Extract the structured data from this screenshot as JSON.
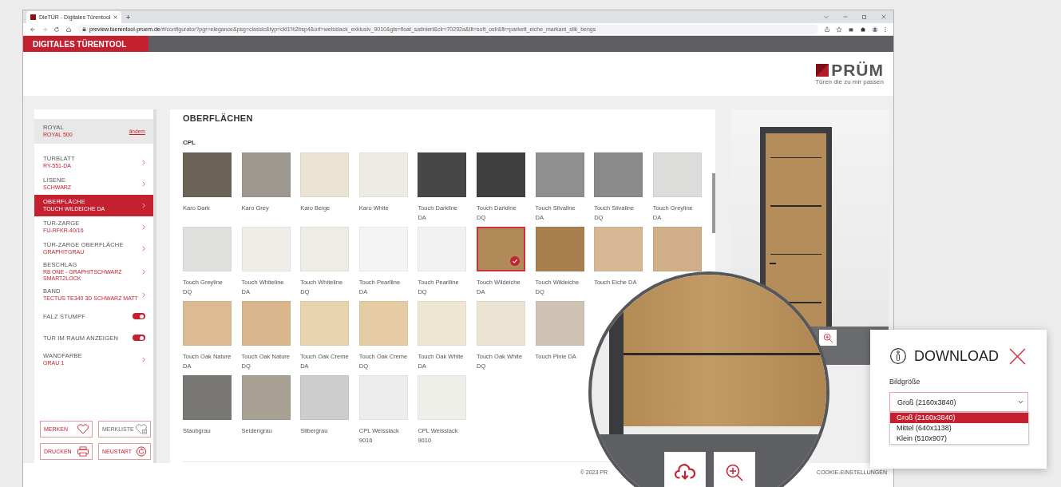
{
  "browser": {
    "tab_title": "DieTÜR - Digitales Türentool",
    "url_host": "preview.tuerentool-pruem.de",
    "url_path": "/#/configurator?pgr=elegance&psg=classic&typ=ckl1%2bsp4&orf=weisslack_exklusiv_9010&gls=float_satiniert&clr=70292a&tlt=soft_oslr&flr=parkett_eiche_markant_silk_bengs"
  },
  "header": {
    "app_title": "DIGITALES TÜRENTOOL"
  },
  "logo": {
    "brand": "PRÜM",
    "tagline": "Türen die zu mir passen"
  },
  "sidebar": {
    "model": {
      "title": "ROYAL",
      "value": "ROYAL 500",
      "link": "ändern"
    },
    "items": [
      {
        "kind": "nav",
        "title": "TÜRBLATT",
        "value": "RY-551-DA",
        "selected": false
      },
      {
        "kind": "nav",
        "title": "LISENE",
        "value": "SCHWARZ",
        "selected": false
      },
      {
        "kind": "nav",
        "title": "OBERFLÄCHE",
        "value": "TOUCH WILDEICHE DA",
        "selected": true
      },
      {
        "kind": "nav",
        "title": "TÜR-ZARGE",
        "value": "FU-RFKR-40/16",
        "selected": false
      },
      {
        "kind": "nav",
        "title": "TÜR-ZARGE OBERFLÄCHE",
        "value": "GRAPHITGRAU",
        "selected": false
      },
      {
        "kind": "nav",
        "title": "BESCHLAG",
        "value": "R8 ONE - GRAPHITSCHWARZ SMART2LOCK",
        "selected": false
      },
      {
        "kind": "nav",
        "title": "BAND",
        "value": "TECTUS TE340 3D SCHWARZ MATT",
        "selected": false
      },
      {
        "kind": "toggle",
        "title": "FALZ STUMPF",
        "on": true,
        "selected": false
      },
      {
        "kind": "toggle",
        "title": "TÜR IM RAUM ANZEIGEN",
        "on": true,
        "selected": false
      },
      {
        "kind": "nav",
        "title": "WANDFARBE",
        "value": "GRAU 1",
        "selected": false
      }
    ],
    "buttons": [
      {
        "label": "MERKEN"
      },
      {
        "label": "MERKLISTE"
      },
      {
        "label": "DRUCKEN"
      },
      {
        "label": "NEUSTART"
      }
    ]
  },
  "main": {
    "title": "OBERFLÄCHEN",
    "group": "CPL",
    "swatch_rows": [
      [
        {
          "label": "Karo Dark",
          "color": "#6b6258",
          "selected": false
        },
        {
          "label": "Karo Grey",
          "color": "#9d9990",
          "selected": false
        },
        {
          "label": "Karo Beige",
          "color": "#ebe4d3",
          "selected": false
        },
        {
          "label": "Karo White",
          "color": "#eeebe4",
          "selected": false
        },
        {
          "label": "Touch Darkline DA",
          "color": "#474747",
          "selected": false
        },
        {
          "label": "Touch Darkline DQ",
          "color": "#404040",
          "selected": false
        },
        {
          "label": "Touch Silvaline DA",
          "color": "#8f8f8f",
          "selected": false
        },
        {
          "label": "Touch Silvaline DQ",
          "color": "#8a8a8a",
          "selected": false
        },
        {
          "label": "Touch Greyline DA",
          "color": "#dcdcda",
          "selected": false
        }
      ],
      [
        {
          "label": "Touch Greyline DQ",
          "color": "#e0e0de",
          "selected": false
        },
        {
          "label": "Touch Whiteline DA",
          "color": "#f0ede8",
          "selected": false
        },
        {
          "label": "Touch Whiteline DQ",
          "color": "#efece6",
          "selected": false
        },
        {
          "label": "Touch Pearlline DA",
          "color": "#f4f4f4",
          "selected": false
        },
        {
          "label": "Touch Pearlline DQ",
          "color": "#f2f2f2",
          "selected": false
        },
        {
          "label": "Touch Wildeiche DA",
          "color": "#b08a58",
          "selected": true
        },
        {
          "label": "Touch Wildeiche DQ",
          "color": "#a88050",
          "selected": false
        },
        {
          "label": "Touch Eiche DA",
          "color": "#d6b895",
          "selected": false
        },
        {
          "color": "#cfae88",
          "selected": false
        }
      ],
      [
        {
          "label": "Touch Oak Nature DA",
          "color": "#dcbb93",
          "selected": false
        },
        {
          "label": "Touch Oak Nature DQ",
          "color": "#d9b68c",
          "selected": false
        },
        {
          "label": "Touch Oak Creme DA",
          "color": "#e9d3ae",
          "selected": false
        },
        {
          "label": "Touch Oak Creme DQ",
          "color": "#e6cca4",
          "selected": false
        },
        {
          "label": "Touch Oak White DA",
          "color": "#efe5d3",
          "selected": false
        },
        {
          "label": "Touch Oak White DQ",
          "color": "#ede3d2",
          "selected": false
        },
        {
          "label": "Touch Pinie DA",
          "color": "#cfc3b6",
          "selected": false
        }
      ],
      [
        {
          "label": "Staubgrau",
          "color": "#7a7874",
          "selected": false
        },
        {
          "label": "Seidengrau",
          "color": "#a8a194",
          "selected": false
        },
        {
          "label": "Silbergrau",
          "color": "#cdcdcd",
          "selected": false
        },
        {
          "label": "CPL Weisslack 9016",
          "color": "#ededed",
          "selected": false
        },
        {
          "label": "CPL Weisslack 9010",
          "color": "#efefea",
          "selected": false
        }
      ]
    ]
  },
  "footer": {
    "copyright": "© 2023 PR",
    "cookie_link": "COOKIE-EINSTELLUNGEN"
  },
  "download_dialog": {
    "title": "DOWNLOAD",
    "field_label": "Bildgröße",
    "value": "Groß (2160x3840)",
    "options": [
      {
        "label": "Groß (2160x3840)",
        "selected": true
      },
      {
        "label": "Mittel (640x1138)",
        "selected": false
      },
      {
        "label": "Klein (510x907)",
        "selected": false
      }
    ]
  }
}
